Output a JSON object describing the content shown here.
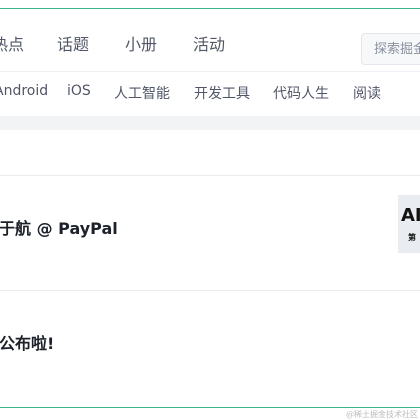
{
  "nav": {
    "items": [
      {
        "label": "热点"
      },
      {
        "label": "话题"
      },
      {
        "label": "小册"
      },
      {
        "label": "活动"
      }
    ],
    "search": {
      "placeholder": "探索掘金"
    }
  },
  "tags": [
    "Android",
    "iOS",
    "人工智能",
    "开发工具",
    "代码人生",
    "阅读"
  ],
  "feed": {
    "items": [
      {
        "title": "于航 @ PayPal",
        "thumbnail": {
          "big_text": "AI",
          "small_text": "第"
        }
      },
      {
        "title": "公布啦!"
      }
    ]
  },
  "footer": {
    "watermark": "@稀土掘金技术社区"
  }
}
